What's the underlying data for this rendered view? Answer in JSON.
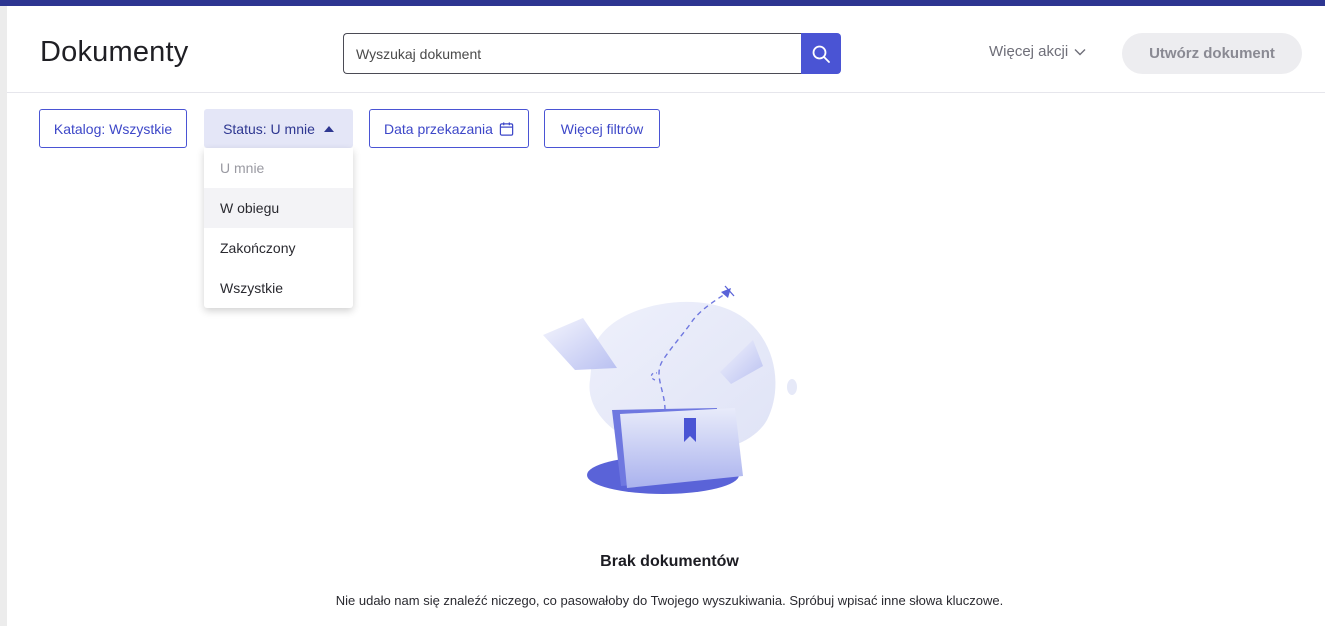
{
  "header": {
    "title": "Dokumenty",
    "search": {
      "placeholder": "Wyszukaj dokument",
      "value": "",
      "button_icon": "search-icon"
    },
    "more_actions_label": "Więcej akcji",
    "create_label": "Utwórz dokument"
  },
  "filters": {
    "catalog_label": "Katalog: Wszystkie",
    "status_label": "Status: U mnie",
    "date_label": "Data przekazania",
    "more_label": "Więcej filtrów"
  },
  "status_dropdown": {
    "items": [
      {
        "label": "U mnie",
        "state": "selected"
      },
      {
        "label": "W obiegu",
        "state": "hover"
      },
      {
        "label": "Zakończony",
        "state": "normal"
      },
      {
        "label": "Wszystkie",
        "state": "normal"
      }
    ]
  },
  "empty_state": {
    "title": "Brak dokumentów",
    "description": "Nie udało nam się znaleźć niczego, co pasowałoby do Twojego wyszukiwania. Spróbuj wpisać inne słowa kluczowe."
  },
  "colors": {
    "accent": "#4a54d4",
    "top_bar": "#2d3591",
    "status_active_bg": "#e4e6f7"
  }
}
